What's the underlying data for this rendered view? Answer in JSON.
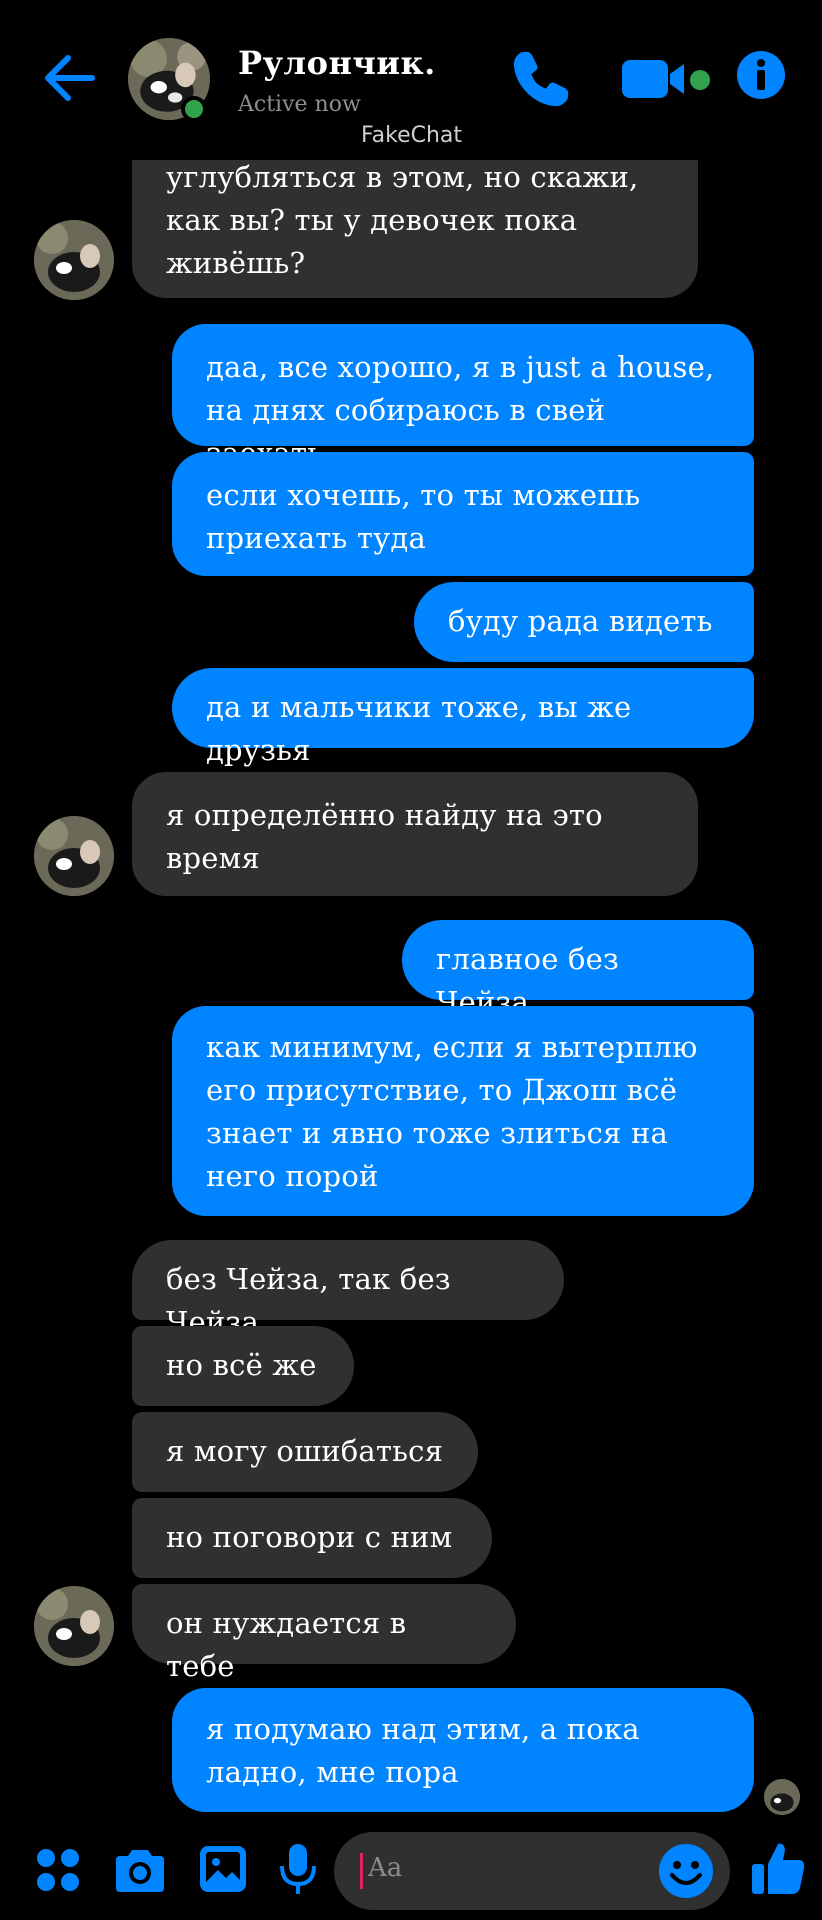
{
  "header": {
    "contact_name": "Рулончик.",
    "status": "Active now",
    "watermark": "FakeChat"
  },
  "colors": {
    "accent": "#0084ff",
    "incoming_bubble": "#303030",
    "online": "#31a24c",
    "background": "#000000"
  },
  "icons": [
    "back-arrow-icon",
    "phone-icon",
    "video-camera-icon",
    "info-icon",
    "apps-grid-icon",
    "camera-icon",
    "image-icon",
    "microphone-icon",
    "emoji-icon",
    "thumbs-up-icon"
  ],
  "messages": [
    {
      "dir": "in",
      "text": "углубляться в этом, но скажи,\nкак вы? ты у девочек пока\nживёшь?"
    },
    {
      "dir": "out",
      "text": "даа, все хорошо, я в just a house,\nна днях собираюсь в свей заехать"
    },
    {
      "dir": "out",
      "text": "если хочешь, то ты можешь\nприехать туда"
    },
    {
      "dir": "out",
      "text": "буду рада видеть"
    },
    {
      "dir": "out",
      "text": "да и мальчики тоже, вы же друзья"
    },
    {
      "dir": "in",
      "text": "я определённо найду на это\nвремя"
    },
    {
      "dir": "out",
      "text": "главное без Чейза"
    },
    {
      "dir": "out",
      "text": "как минимум, если я вытерплю\nего присутствие, то Джош всё\nзнает и явно тоже злиться на\nнего порой"
    },
    {
      "dir": "in",
      "text": "без Чейза, так без Чейза"
    },
    {
      "dir": "in",
      "text": "но всё же"
    },
    {
      "dir": "in",
      "text": "я могу ошибаться"
    },
    {
      "dir": "in",
      "text": "но поговори с ним"
    },
    {
      "dir": "in",
      "text": "он нуждается в тебе"
    },
    {
      "dir": "out",
      "text": "я подумаю над этим, а пока\nладно, мне пора"
    }
  ],
  "composer": {
    "placeholder": "Aa"
  }
}
